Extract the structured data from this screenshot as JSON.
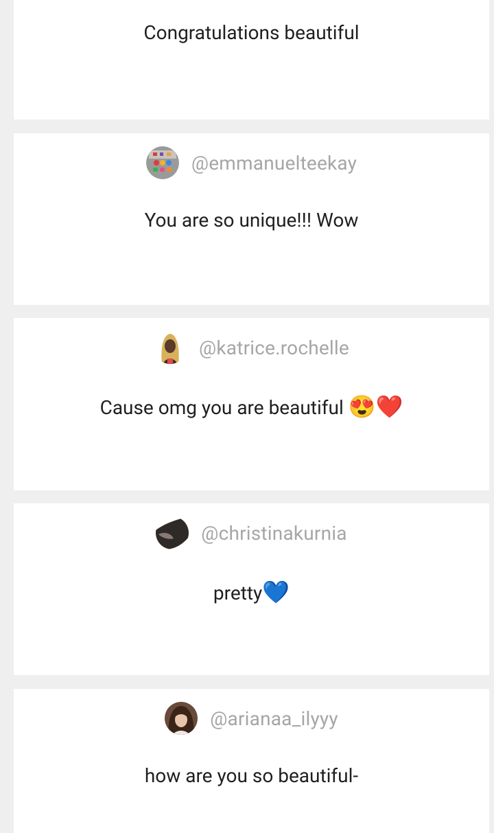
{
  "comments": [
    {
      "username": "",
      "text": "Congratulations beautiful",
      "emoji": ""
    },
    {
      "username": "@emmanuelteekay",
      "text": "You are so unique!!! Wow",
      "emoji": "",
      "avatar_icon": "colorful-shapes-avatar"
    },
    {
      "username": "@katrice.rochelle",
      "text": "Cause omg you are beautiful ",
      "emoji": "😍❤️",
      "avatar_icon": "woman-blonde-avatar"
    },
    {
      "username": "@christinakurnia",
      "text": "pretty",
      "emoji": "💙",
      "avatar_icon": "dark-photo-avatar"
    },
    {
      "username": "@arianaa_ilyyy",
      "text": "how are you so beautiful-",
      "emoji": "",
      "avatar_icon": "woman-brunette-avatar"
    }
  ],
  "colors": {
    "background": "#efefef",
    "card": "#ffffff",
    "username": "#a6a6a6",
    "text": "#1f1f1f"
  }
}
